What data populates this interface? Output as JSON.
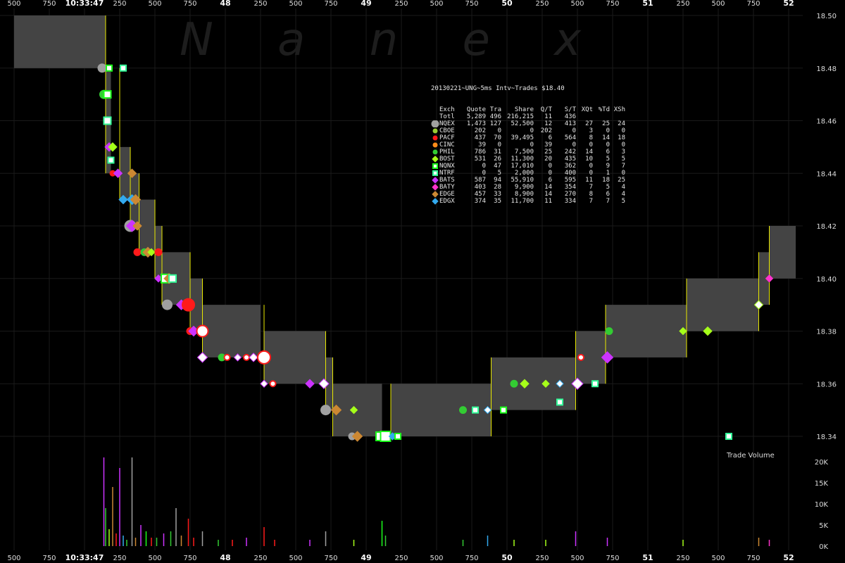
{
  "chart_data": {
    "type": "scatter",
    "watermark": "N a n e x",
    "info_title": "20130221~UNG~5ms Intv~Trades $18.40",
    "time_axis": {
      "labels": [
        "500",
        "750",
        "10:33:47",
        "250",
        "500",
        "750",
        "48",
        "250",
        "500",
        "750",
        "49",
        "250",
        "500",
        "750",
        "50",
        "250",
        "500",
        "750",
        "51",
        "250",
        "500",
        "750",
        "52"
      ],
      "major": [
        2,
        6,
        10,
        14,
        18,
        22
      ]
    },
    "price_axis": {
      "ylim": [
        18.33,
        18.5
      ],
      "ticks": [
        18.5,
        18.48,
        18.46,
        18.44,
        18.42,
        18.4,
        18.38,
        18.36,
        18.34
      ],
      "tick_labels": [
        "18.50",
        "18.48",
        "18.46",
        "18.44",
        "18.42",
        "18.40",
        "18.38",
        "18.36",
        "18.34"
      ]
    },
    "volume_axis": {
      "title": "Trade Volume",
      "ylim": [
        0,
        22000
      ],
      "ticks": [
        0,
        5000,
        10000,
        15000,
        20000
      ],
      "tick_labels": [
        "0K",
        "5K",
        "10K",
        "15K",
        "20K"
      ]
    },
    "quote_bands": [
      {
        "t0": 0.0,
        "t1": 2.6,
        "bid": 18.48,
        "ask": 18.5
      },
      {
        "t0": 2.6,
        "t1": 2.75,
        "bid": 18.44,
        "ask": 18.48
      },
      {
        "t0": 3.0,
        "t1": 3.3,
        "bid": 18.43,
        "ask": 18.45
      },
      {
        "t0": 3.3,
        "t1": 3.55,
        "bid": 18.42,
        "ask": 18.44
      },
      {
        "t0": 3.55,
        "t1": 4.0,
        "bid": 18.41,
        "ask": 18.43
      },
      {
        "t0": 4.0,
        "t1": 4.2,
        "bid": 18.4,
        "ask": 18.42
      },
      {
        "t0": 4.2,
        "t1": 5.0,
        "bid": 18.39,
        "ask": 18.41
      },
      {
        "t0": 5.0,
        "t1": 5.35,
        "bid": 18.38,
        "ask": 18.4
      },
      {
        "t0": 5.35,
        "t1": 7.0,
        "bid": 18.37,
        "ask": 18.39
      },
      {
        "t0": 7.1,
        "t1": 8.85,
        "bid": 18.36,
        "ask": 18.38
      },
      {
        "t0": 8.85,
        "t1": 9.05,
        "bid": 18.35,
        "ask": 18.37
      },
      {
        "t0": 9.05,
        "t1": 10.45,
        "bid": 18.34,
        "ask": 18.36
      },
      {
        "t0": 10.7,
        "t1": 13.55,
        "bid": 18.34,
        "ask": 18.36
      },
      {
        "t0": 13.55,
        "t1": 15.95,
        "bid": 18.35,
        "ask": 18.37
      },
      {
        "t0": 15.95,
        "t1": 16.8,
        "bid": 18.36,
        "ask": 18.38
      },
      {
        "t0": 16.8,
        "t1": 19.1,
        "bid": 18.37,
        "ask": 18.39
      },
      {
        "t0": 19.1,
        "t1": 21.15,
        "bid": 18.38,
        "ask": 18.4
      },
      {
        "t0": 21.15,
        "t1": 21.45,
        "bid": 18.39,
        "ask": 18.41
      },
      {
        "t0": 21.45,
        "t1": 22.2,
        "bid": 18.4,
        "ask": 18.42
      }
    ],
    "trades": [
      {
        "t": 2.5,
        "p": 18.48,
        "ex": "NQEX",
        "s": 6
      },
      {
        "t": 2.7,
        "p": 18.48,
        "ex": "NQNX",
        "s": 4
      },
      {
        "t": 3.1,
        "p": 18.48,
        "ex": "NTRF",
        "s": 4
      },
      {
        "t": 2.55,
        "p": 18.47,
        "ex": "PHIL",
        "s": 6
      },
      {
        "t": 2.65,
        "p": 18.47,
        "ex": "NQNX",
        "s": 5
      },
      {
        "t": 2.65,
        "p": 18.46,
        "ex": "NTRF",
        "s": 5
      },
      {
        "t": 2.7,
        "p": 18.45,
        "ex": "BATS",
        "s": 5
      },
      {
        "t": 2.8,
        "p": 18.45,
        "ex": "BOST",
        "s": 5
      },
      {
        "t": 2.75,
        "p": 18.445,
        "ex": "NTRF",
        "s": 4
      },
      {
        "t": 2.8,
        "p": 18.44,
        "ex": "PACF",
        "s": 4
      },
      {
        "t": 2.95,
        "p": 18.44,
        "ex": "BATS",
        "s": 5
      },
      {
        "t": 3.35,
        "p": 18.44,
        "ex": "EDGE",
        "s": 5
      },
      {
        "t": 3.1,
        "p": 18.43,
        "ex": "EDGX",
        "s": 5
      },
      {
        "t": 3.35,
        "p": 18.43,
        "ex": "EDGX",
        "s": 6
      },
      {
        "t": 3.45,
        "p": 18.43,
        "ex": "EDGE",
        "s": 6
      },
      {
        "t": 3.3,
        "p": 18.42,
        "ex": "NQEX",
        "s": 8
      },
      {
        "t": 3.35,
        "p": 18.42,
        "ex": "BATS",
        "s": 7
      },
      {
        "t": 3.5,
        "p": 18.42,
        "ex": "EDGE",
        "s": 5
      },
      {
        "t": 3.5,
        "p": 18.41,
        "ex": "PACF",
        "s": 5
      },
      {
        "t": 3.7,
        "p": 18.41,
        "ex": "PHIL",
        "s": 5
      },
      {
        "t": 3.8,
        "p": 18.41,
        "ex": "EDGE",
        "s": 6
      },
      {
        "t": 3.9,
        "p": 18.41,
        "ex": "BOST",
        "s": 4
      },
      {
        "t": 4.1,
        "p": 18.41,
        "ex": "PACF",
        "s": 5
      },
      {
        "t": 4.1,
        "p": 18.4,
        "ex": "BATS",
        "s": 4
      },
      {
        "t": 4.3,
        "p": 18.4,
        "ex": "NQNX",
        "s": 6
      },
      {
        "t": 4.4,
        "p": 18.4,
        "ex": "EDGE",
        "s": 6
      },
      {
        "t": 4.5,
        "p": 18.4,
        "ex": "NTRF",
        "s": 5
      },
      {
        "t": 4.35,
        "p": 18.39,
        "ex": "NQEX",
        "s": 7
      },
      {
        "t": 4.75,
        "p": 18.39,
        "ex": "BATS",
        "s": 6
      },
      {
        "t": 4.95,
        "p": 18.39,
        "ex": "PACF",
        "s": 9
      },
      {
        "t": 5.0,
        "p": 18.38,
        "ex": "PACF",
        "s": 5
      },
      {
        "t": 5.1,
        "p": 18.38,
        "ex": "BATS",
        "s": 6
      },
      {
        "t": 5.35,
        "p": 18.38,
        "ex": "PACF",
        "s": 8,
        "hollow": true
      },
      {
        "t": 5.35,
        "p": 18.37,
        "ex": "BATS",
        "s": 6,
        "hollow": true
      },
      {
        "t": 5.9,
        "p": 18.37,
        "ex": "PHIL",
        "s": 5
      },
      {
        "t": 6.05,
        "p": 18.37,
        "ex": "PACF",
        "s": 4,
        "hollow": true
      },
      {
        "t": 6.35,
        "p": 18.37,
        "ex": "BATS",
        "s": 4,
        "hollow": true
      },
      {
        "t": 6.6,
        "p": 18.37,
        "ex": "PACF",
        "s": 4,
        "hollow": true
      },
      {
        "t": 6.8,
        "p": 18.37,
        "ex": "BATS",
        "s": 5,
        "hollow": true
      },
      {
        "t": 7.1,
        "p": 18.37,
        "ex": "PACF",
        "s": 9,
        "hollow": true
      },
      {
        "t": 7.1,
        "p": 18.36,
        "ex": "BATS",
        "s": 4,
        "hollow": true
      },
      {
        "t": 7.35,
        "p": 18.36,
        "ex": "PACF",
        "s": 4,
        "hollow": true
      },
      {
        "t": 8.4,
        "p": 18.36,
        "ex": "BATS",
        "s": 5
      },
      {
        "t": 8.8,
        "p": 18.36,
        "ex": "BATS",
        "s": 6,
        "hollow": true
      },
      {
        "t": 8.85,
        "p": 18.35,
        "ex": "NQEX",
        "s": 7
      },
      {
        "t": 9.15,
        "p": 18.35,
        "ex": "EDGE",
        "s": 6
      },
      {
        "t": 9.65,
        "p": 18.35,
        "ex": "BOST",
        "s": 4
      },
      {
        "t": 9.6,
        "p": 18.34,
        "ex": "NQEX",
        "s": 5
      },
      {
        "t": 9.75,
        "p": 18.34,
        "ex": "EDGE",
        "s": 6
      },
      {
        "t": 10.4,
        "p": 18.34,
        "ex": "NQNX",
        "s": 6,
        "hollow": true
      },
      {
        "t": 10.55,
        "p": 18.34,
        "ex": "NQNX",
        "s": 7,
        "hollow": true
      },
      {
        "t": 10.75,
        "p": 18.34,
        "ex": "EDGX",
        "s": 4
      },
      {
        "t": 10.9,
        "p": 18.34,
        "ex": "NQNX",
        "s": 4
      },
      {
        "t": 12.75,
        "p": 18.35,
        "ex": "PHIL",
        "s": 5
      },
      {
        "t": 13.1,
        "p": 18.35,
        "ex": "NTRF",
        "s": 4
      },
      {
        "t": 13.45,
        "p": 18.35,
        "ex": "EDGX",
        "s": 4,
        "hollow": true
      },
      {
        "t": 13.9,
        "p": 18.35,
        "ex": "NQNX",
        "s": 4
      },
      {
        "t": 14.2,
        "p": 18.36,
        "ex": "PHIL",
        "s": 5
      },
      {
        "t": 14.5,
        "p": 18.36,
        "ex": "BOST",
        "s": 5
      },
      {
        "t": 15.1,
        "p": 18.36,
        "ex": "BOST",
        "s": 4
      },
      {
        "t": 15.5,
        "p": 18.36,
        "ex": "EDGX",
        "s": 4,
        "hollow": true
      },
      {
        "t": 16.0,
        "p": 18.36,
        "ex": "BATS",
        "s": 7,
        "hollow": true
      },
      {
        "t": 15.5,
        "p": 18.353,
        "ex": "NTRF",
        "s": 4
      },
      {
        "t": 16.5,
        "p": 18.36,
        "ex": "NTRF",
        "s": 4
      },
      {
        "t": 16.1,
        "p": 18.37,
        "ex": "PACF",
        "s": 4,
        "hollow": true
      },
      {
        "t": 16.85,
        "p": 18.37,
        "ex": "BATS",
        "s": 7
      },
      {
        "t": 16.9,
        "p": 18.38,
        "ex": "PHIL",
        "s": 5
      },
      {
        "t": 19.0,
        "p": 18.38,
        "ex": "BOST",
        "s": 4
      },
      {
        "t": 19.7,
        "p": 18.38,
        "ex": "BOST",
        "s": 5
      },
      {
        "t": 20.3,
        "p": 18.34,
        "ex": "NTRF",
        "s": 4
      },
      {
        "t": 21.15,
        "p": 18.39,
        "ex": "BOST",
        "s": 5,
        "hollow": true
      },
      {
        "t": 21.45,
        "p": 18.4,
        "ex": "BATY",
        "s": 4
      }
    ],
    "volume_bars": [
      {
        "t": 2.55,
        "v": 21000,
        "ex": "BATS"
      },
      {
        "t": 2.6,
        "v": 9000,
        "ex": "PHIL"
      },
      {
        "t": 2.7,
        "v": 4000,
        "ex": "BOST"
      },
      {
        "t": 2.8,
        "v": 14000,
        "ex": "EDGE"
      },
      {
        "t": 2.9,
        "v": 3000,
        "ex": "PACF"
      },
      {
        "t": 3.0,
        "v": 18500,
        "ex": "BATS"
      },
      {
        "t": 3.1,
        "v": 2500,
        "ex": "EDGX"
      },
      {
        "t": 3.2,
        "v": 1500,
        "ex": "PHIL"
      },
      {
        "t": 3.35,
        "v": 21000,
        "ex": "NQEX"
      },
      {
        "t": 3.45,
        "v": 2000,
        "ex": "EDGE"
      },
      {
        "t": 3.6,
        "v": 5000,
        "ex": "BATS"
      },
      {
        "t": 3.75,
        "v": 3500,
        "ex": "NQNX"
      },
      {
        "t": 3.9,
        "v": 2000,
        "ex": "PACF"
      },
      {
        "t": 4.05,
        "v": 2000,
        "ex": "PHIL"
      },
      {
        "t": 4.25,
        "v": 3000,
        "ex": "BATS"
      },
      {
        "t": 4.45,
        "v": 3500,
        "ex": "PHIL"
      },
      {
        "t": 4.6,
        "v": 9000,
        "ex": "NQEX"
      },
      {
        "t": 4.75,
        "v": 2500,
        "ex": "EDGE"
      },
      {
        "t": 4.95,
        "v": 6500,
        "ex": "PACF"
      },
      {
        "t": 5.1,
        "v": 2000,
        "ex": "PACF"
      },
      {
        "t": 5.35,
        "v": 3500,
        "ex": "NQEX"
      },
      {
        "t": 5.8,
        "v": 1500,
        "ex": "PHIL"
      },
      {
        "t": 6.2,
        "v": 1500,
        "ex": "PACF"
      },
      {
        "t": 6.6,
        "v": 2000,
        "ex": "BATS"
      },
      {
        "t": 7.1,
        "v": 4500,
        "ex": "PACF"
      },
      {
        "t": 7.4,
        "v": 1500,
        "ex": "PACF"
      },
      {
        "t": 8.4,
        "v": 1500,
        "ex": "BATS"
      },
      {
        "t": 8.85,
        "v": 3500,
        "ex": "NQEX"
      },
      {
        "t": 9.65,
        "v": 1500,
        "ex": "BOST"
      },
      {
        "t": 10.45,
        "v": 6000,
        "ex": "NQNX"
      },
      {
        "t": 10.55,
        "v": 2500,
        "ex": "PHIL"
      },
      {
        "t": 12.75,
        "v": 1500,
        "ex": "PHIL"
      },
      {
        "t": 13.45,
        "v": 2500,
        "ex": "EDGX"
      },
      {
        "t": 14.2,
        "v": 1500,
        "ex": "BOST"
      },
      {
        "t": 15.1,
        "v": 1500,
        "ex": "BOST"
      },
      {
        "t": 15.95,
        "v": 3500,
        "ex": "BATS"
      },
      {
        "t": 16.85,
        "v": 2000,
        "ex": "BATS"
      },
      {
        "t": 19.0,
        "v": 1500,
        "ex": "BOST"
      },
      {
        "t": 21.15,
        "v": 2000,
        "ex": "EDGE"
      },
      {
        "t": 21.45,
        "v": 1500,
        "ex": "BATY"
      }
    ],
    "legend": {
      "headers": [
        "Exch",
        "Quote",
        "Tra",
        "Share",
        "Q/T",
        "S/T",
        "XQt",
        "%Td",
        "XSh"
      ],
      "total": [
        "Totl",
        "5,289",
        "496",
        "216,215",
        "11",
        "436",
        "",
        "",
        ""
      ],
      "rows": [
        {
          "ex": "NQEX",
          "cells": [
            "NQEX",
            "1,473",
            "127",
            "52,500",
            "12",
            "413",
            "27",
            "25",
            "24"
          ]
        },
        {
          "ex": "CBOE",
          "cells": [
            "CBOE",
            "202",
            "0",
            "0",
            "202",
            "0",
            "3",
            "0",
            "0"
          ]
        },
        {
          "ex": "PACF",
          "cells": [
            "PACF",
            "437",
            "70",
            "39,495",
            "6",
            "564",
            "8",
            "14",
            "18"
          ]
        },
        {
          "ex": "CINC",
          "cells": [
            "CINC",
            "39",
            "0",
            "0",
            "39",
            "0",
            "0",
            "0",
            "0"
          ]
        },
        {
          "ex": "PHIL",
          "cells": [
            "PHIL",
            "786",
            "31",
            "7,500",
            "25",
            "242",
            "14",
            "6",
            "3"
          ]
        },
        {
          "ex": "BOST",
          "cells": [
            "BOST",
            "531",
            "26",
            "11,300",
            "20",
            "435",
            "10",
            "5",
            "5"
          ]
        },
        {
          "ex": "NQNX",
          "cells": [
            "NQNX",
            "0",
            "47",
            "17,010",
            "0",
            "362",
            "0",
            "9",
            "7"
          ]
        },
        {
          "ex": "NTRF",
          "cells": [
            "NTRF",
            "0",
            "5",
            "2,000",
            "0",
            "400",
            "0",
            "1",
            "0"
          ]
        },
        {
          "ex": "BATS",
          "cells": [
            "BATS",
            "587",
            "94",
            "55,910",
            "6",
            "595",
            "11",
            "18",
            "25"
          ]
        },
        {
          "ex": "BATY",
          "cells": [
            "BATY",
            "403",
            "28",
            "9,900",
            "14",
            "354",
            "7",
            "5",
            "4"
          ]
        },
        {
          "ex": "EDGE",
          "cells": [
            "EDGE",
            "457",
            "33",
            "8,900",
            "14",
            "270",
            "8",
            "6",
            "4"
          ]
        },
        {
          "ex": "EDGX",
          "cells": [
            "EDGX",
            "374",
            "35",
            "11,700",
            "11",
            "334",
            "7",
            "7",
            "5"
          ]
        }
      ]
    },
    "exchange_style": {
      "NQEX": {
        "color": "#a0a0a0",
        "shape": "circle"
      },
      "CBOE": {
        "color": "#99cc33",
        "shape": "circle"
      },
      "PACF": {
        "color": "#ff1a1a",
        "shape": "circle"
      },
      "CINC": {
        "color": "#ff8c1a",
        "shape": "circle"
      },
      "PHIL": {
        "color": "#33cc33",
        "shape": "circle"
      },
      "BOST": {
        "color": "#a6ff1a",
        "shape": "diamond"
      },
      "NQNX": {
        "color": "#1aff1a",
        "shape": "square"
      },
      "NTRF": {
        "color": "#33ff99",
        "shape": "square"
      },
      "BATS": {
        "color": "#cc33ff",
        "shape": "diamond"
      },
      "BATY": {
        "color": "#ff33cc",
        "shape": "diamond"
      },
      "EDGE": {
        "color": "#cc8833",
        "shape": "diamond"
      },
      "EDGX": {
        "color": "#33aaee",
        "shape": "diamond"
      }
    },
    "colors": {
      "background": "#000000",
      "band": "#444444",
      "grid": "#1a1a1a",
      "quote_line": "#e8e800"
    }
  }
}
